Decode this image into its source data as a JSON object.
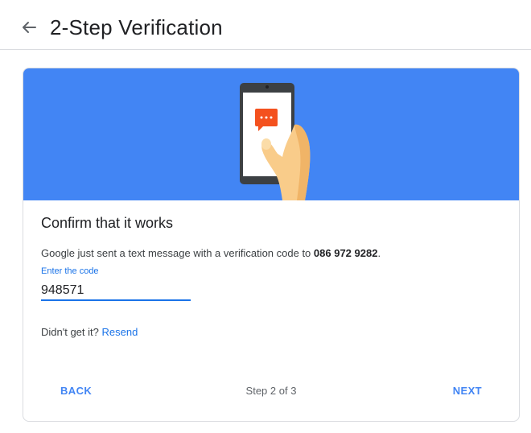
{
  "header": {
    "title": "2-Step Verification",
    "back_icon": "arrow-left-icon"
  },
  "banner": {
    "illustration": "phone-message-illustration",
    "background_color": "#4285f4",
    "message_bubble_color": "#f4511e"
  },
  "card": {
    "title": "Confirm that it works",
    "description_prefix": "Google just sent a text message with a verification code to ",
    "phone_number": "086 972 9282",
    "description_suffix": ".",
    "code_label": "Enter the code",
    "code_value": "948571",
    "resend_prompt": "Didn't get it?",
    "resend_link": "Resend"
  },
  "footer": {
    "back_label": "BACK",
    "step_text": "Step 2 of 3",
    "next_label": "NEXT"
  }
}
